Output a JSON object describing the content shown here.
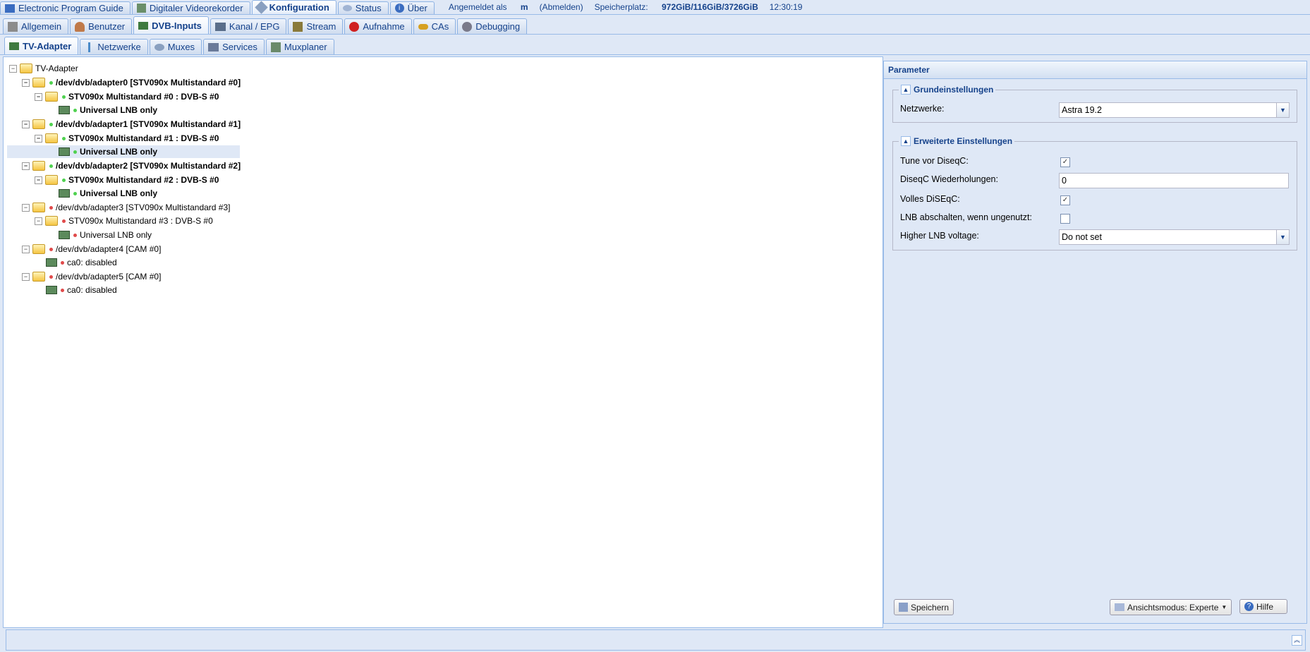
{
  "top_tabs": [
    {
      "label": "Electronic Program Guide",
      "icon": "epg-icon"
    },
    {
      "label": "Digitaler Videorekorder",
      "icon": "download-icon"
    },
    {
      "label": "Konfiguration",
      "icon": "wrench-icon",
      "active": true
    },
    {
      "label": "Status",
      "icon": "eye-icon"
    },
    {
      "label": "Über",
      "icon": "info-icon"
    }
  ],
  "top_info": {
    "logged_in_label": "Angemeldet als",
    "user": "m",
    "logout": "(Abmelden)",
    "storage_label": "Speicherplatz:",
    "storage_value": "972GiB/116GiB/3726GiB",
    "clock": "12:30:19"
  },
  "second_tabs": [
    {
      "label": "Allgemein",
      "icon": "tools-icon"
    },
    {
      "label": "Benutzer",
      "icon": "users-icon"
    },
    {
      "label": "DVB-Inputs",
      "icon": "tv-card-icon",
      "active": true
    },
    {
      "label": "Kanal / EPG",
      "icon": "tv-icon"
    },
    {
      "label": "Stream",
      "icon": "stream-icon"
    },
    {
      "label": "Aufnahme",
      "icon": "rec-icon"
    },
    {
      "label": "CAs",
      "icon": "key-icon"
    },
    {
      "label": "Debugging",
      "icon": "bug-icon"
    }
  ],
  "third_tabs": [
    {
      "label": "TV-Adapter",
      "icon": "tv-card-icon",
      "active": true
    },
    {
      "label": "Netzwerke",
      "icon": "antenna-icon"
    },
    {
      "label": "Muxes",
      "icon": "satellite-icon"
    },
    {
      "label": "Services",
      "icon": "services-icon"
    },
    {
      "label": "Muxplaner",
      "icon": "planner-icon"
    }
  ],
  "tree": {
    "root": "TV-Adapter",
    "nodes": [
      {
        "label": "/dev/dvb/adapter0 [STV090x Multistandard #0]",
        "status": "green",
        "bold": true
      },
      {
        "label": "STV090x Multistandard #0 : DVB-S #0",
        "status": "green",
        "bold": true
      },
      {
        "label": "Universal LNB only",
        "status": "green",
        "bold": true
      },
      {
        "label": "/dev/dvb/adapter1 [STV090x Multistandard #1]",
        "status": "green",
        "bold": true
      },
      {
        "label": "STV090x Multistandard #1 : DVB-S #0",
        "status": "green",
        "bold": true
      },
      {
        "label": "Universal LNB only",
        "status": "green",
        "bold": true,
        "selected": true
      },
      {
        "label": "/dev/dvb/adapter2 [STV090x Multistandard #2]",
        "status": "green",
        "bold": true
      },
      {
        "label": "STV090x Multistandard #2 : DVB-S #0",
        "status": "green",
        "bold": true
      },
      {
        "label": "Universal LNB only",
        "status": "green",
        "bold": true
      },
      {
        "label": "/dev/dvb/adapter3 [STV090x Multistandard #3]",
        "status": "red",
        "bold": false
      },
      {
        "label": "STV090x Multistandard #3 : DVB-S #0",
        "status": "red",
        "bold": false
      },
      {
        "label": "Universal LNB only",
        "status": "red",
        "bold": false
      },
      {
        "label": "/dev/dvb/adapter4 [CAM #0]",
        "status": "red",
        "bold": false
      },
      {
        "label": "ca0: disabled",
        "status": "red",
        "bold": false
      },
      {
        "label": "/dev/dvb/adapter5 [CAM #0]",
        "status": "red",
        "bold": false
      },
      {
        "label": "ca0: disabled",
        "status": "red",
        "bold": false
      }
    ]
  },
  "params": {
    "title": "Parameter",
    "basic": {
      "legend": "Grundeinstellungen",
      "networks_label": "Netzwerke:",
      "networks_value": "Astra 19.2"
    },
    "advanced": {
      "legend": "Erweiterte Einstellungen",
      "tune_label": "Tune vor DiseqC:",
      "tune_checked": true,
      "repeats_label": "DiseqC Wiederholungen:",
      "repeats_value": "0",
      "full_label": "Volles DiSEqC:",
      "full_checked": true,
      "lnb_off_label": "LNB abschalten, wenn ungenutzt:",
      "lnb_off_checked": false,
      "voltage_label": "Higher LNB voltage:",
      "voltage_value": "Do not set"
    },
    "buttons": {
      "save": "Speichern",
      "view_mode": "Ansichtsmodus: Experte",
      "help": "Hilfe"
    }
  }
}
